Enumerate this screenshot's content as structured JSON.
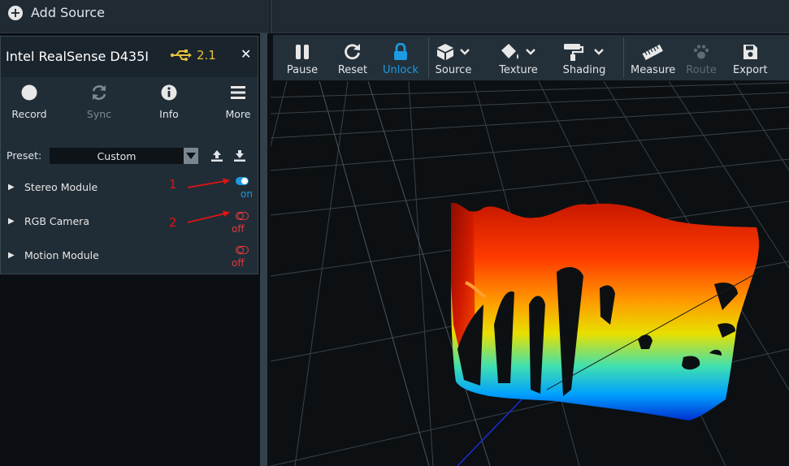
{
  "topbar": {
    "add_source_label": "Add Source"
  },
  "device": {
    "name": "Intel RealSense D435I",
    "usb_version": "2.1",
    "buttons": [
      {
        "label": "Record",
        "enabled": true
      },
      {
        "label": "Sync",
        "enabled": false
      },
      {
        "label": "Info",
        "enabled": true
      },
      {
        "label": "More",
        "enabled": true
      }
    ],
    "preset": {
      "label": "Preset:",
      "value": "Custom"
    },
    "modules": [
      {
        "name": "Stereo Module",
        "state": "on",
        "marker": "1"
      },
      {
        "name": "RGB Camera",
        "state": "off",
        "marker": "2"
      },
      {
        "name": "Motion Module",
        "state": "off",
        "marker": ""
      }
    ]
  },
  "toolbar": {
    "buttons": [
      {
        "label": "Pause"
      },
      {
        "label": "Reset"
      },
      {
        "label": "Unlock"
      },
      {
        "label": "Source"
      },
      {
        "label": "Texture"
      },
      {
        "label": "Shading"
      },
      {
        "label": "Measure"
      },
      {
        "label": "Route"
      },
      {
        "label": "Export"
      }
    ]
  },
  "colors": {
    "accent_blue": "#1b9be0",
    "off_red": "#e0393e",
    "usb_yellow": "#e5c23e",
    "annotation_red": "#e01414"
  }
}
